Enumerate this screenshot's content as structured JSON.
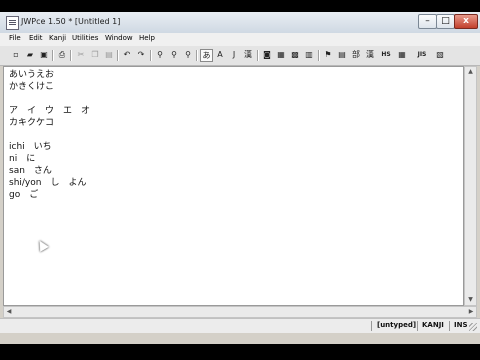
{
  "window": {
    "title": "JWPce 1.50 * [Untitled 1]",
    "min_label": "–",
    "max_label": "□",
    "close_label": "x"
  },
  "menu": [
    "File",
    "Edit",
    "Kanji",
    "Utilities",
    "Window",
    "Help"
  ],
  "toolbar": {
    "hiragana_label": "あ",
    "ascii_label": "A",
    "jis_label": "J",
    "kanji_label": "漢",
    "radical_label": "部",
    "hs_label": "HS",
    "jis_code_label": "JIS"
  },
  "document": {
    "lines": [
      "あいうえお",
      "かきくけこ",
      "",
      "ア　イ　ウ　エ　オ",
      "カキクケコ",
      "",
      "ichi　いち",
      "ni　に",
      "san　さん",
      "shi/yon　し　よん",
      "go　ご"
    ]
  },
  "status": {
    "mode": "[untyped]",
    "input": "KANJI",
    "insert": "INS"
  }
}
